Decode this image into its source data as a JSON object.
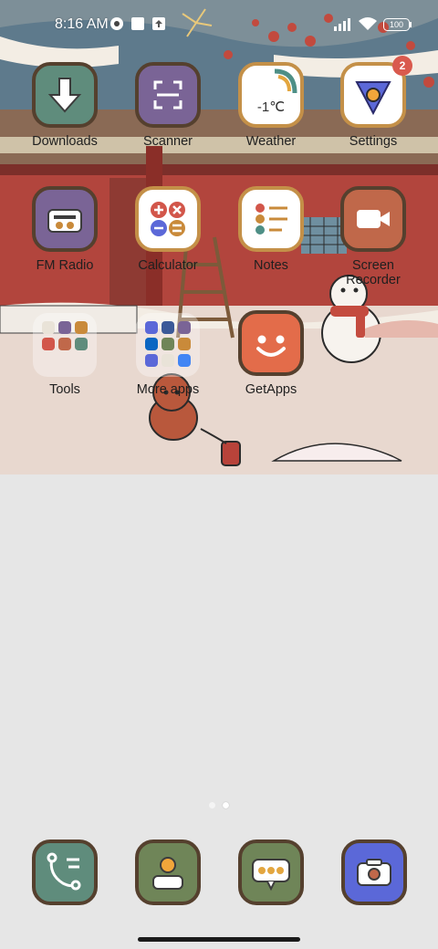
{
  "status_bar": {
    "time": "8:16 AM",
    "battery": "100",
    "icons": [
      "pinwheel-icon",
      "square-notification-icon",
      "upload-icon",
      "signal-icon",
      "wifi-icon",
      "battery-icon"
    ]
  },
  "home": {
    "apps": [
      {
        "label": "Downloads",
        "icon": "download-arrow-icon",
        "color": "#5f8c7c"
      },
      {
        "label": "Scanner",
        "icon": "scan-frame-icon",
        "color": "#7a6496"
      },
      {
        "label": "Weather",
        "icon": "weather-icon",
        "color": "#ffffff",
        "temp": "-1℃"
      },
      {
        "label": "Settings",
        "icon": "settings-icon",
        "color": "#ffffff",
        "badge": "2"
      },
      {
        "label": "FM Radio",
        "icon": "radio-icon",
        "color": "#7a6496"
      },
      {
        "label": "Calculator",
        "icon": "calculator-icon",
        "color": "#ffffff"
      },
      {
        "label": "Notes",
        "icon": "notes-list-icon",
        "color": "#ffffff"
      },
      {
        "label": "Screen\nRecorder",
        "icon": "video-camera-icon",
        "color": "#c0684a"
      },
      {
        "label": "Tools",
        "icon": "folder-icon"
      },
      {
        "label": "More apps",
        "icon": "folder-icon"
      },
      {
        "label": "GetApps",
        "icon": "smiley-face-icon",
        "color": "#e36c4a"
      }
    ]
  },
  "dock": [
    {
      "name": "phone",
      "icon": "phone-icon",
      "color": "#5f8c7c"
    },
    {
      "name": "contacts",
      "icon": "contacts-icon",
      "color": "#6f8558"
    },
    {
      "name": "messages",
      "icon": "message-icon",
      "color": "#6f8558"
    },
    {
      "name": "camera",
      "icon": "camera-icon",
      "color": "#5b68d8"
    }
  ],
  "page_indicator": {
    "pages": 2,
    "current": 2
  },
  "colors": {
    "background": "#e6e6e6",
    "wall_red": "#b2453d",
    "roof_blue": "#5e7a8c",
    "snow": "#f3ede4"
  }
}
